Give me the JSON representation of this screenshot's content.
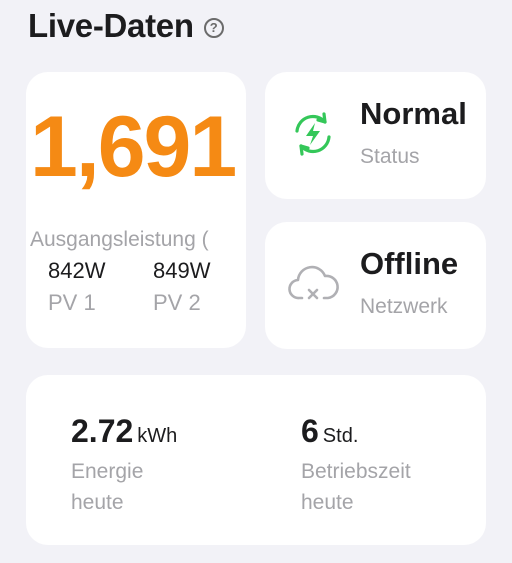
{
  "header": {
    "title": "Live-Daten",
    "help_icon": "question-circle-icon"
  },
  "output": {
    "value": "1,691",
    "label": "Ausgangsleistung (",
    "pv": [
      {
        "value": "842W",
        "label": "PV 1"
      },
      {
        "value": "849W",
        "label": "PV 2"
      }
    ]
  },
  "status": {
    "value": "Normal",
    "label": "Status",
    "icon": "refresh-bolt-icon",
    "color": "#34c759"
  },
  "network": {
    "value": "Offline",
    "label": "Netzwerk",
    "icon": "cloud-offline-icon"
  },
  "energy": {
    "today": {
      "value": "2.72",
      "unit": "kWh",
      "label_line1": "Energie",
      "label_line2": "heute"
    },
    "runtime": {
      "value": "6",
      "unit": "Std.",
      "label_line1": "Betriebszeit",
      "label_line2": "heute"
    }
  },
  "colors": {
    "accent": "#f58a14",
    "status_ok": "#34c759",
    "muted": "#a4a4a8"
  }
}
